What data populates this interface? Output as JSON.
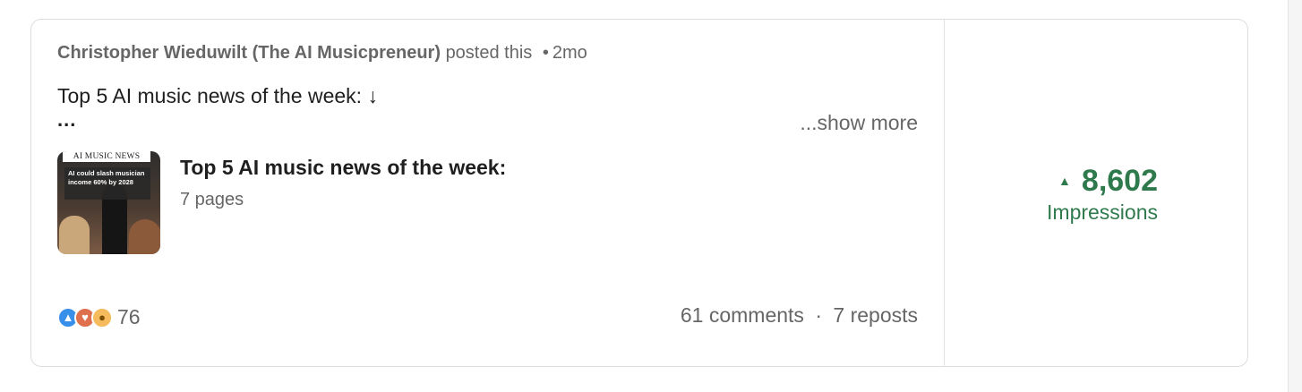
{
  "post": {
    "author": "Christopher Wieduwilt (The AI Musicpreneur)",
    "action": "posted this",
    "separator": "•",
    "age": "2mo",
    "text": "Top 5 AI music news of the week: ↓",
    "ellipsis": "...",
    "show_more": "...show more"
  },
  "document": {
    "thumbnail_masthead": "AI MUSIC NEWS",
    "thumbnail_headline": "AI could slash musician income 60% by 2028",
    "title": "Top 5 AI music news of the week:",
    "pages": "7 pages"
  },
  "engagement": {
    "reaction_icons": [
      "like-icon",
      "love-icon",
      "insightful-icon"
    ],
    "reaction_count": "76",
    "comments": "61 comments",
    "dot": "·",
    "reposts": "7 reposts"
  },
  "stats": {
    "trend_icon": "triangle-up-icon",
    "impressions_value": "8,602",
    "impressions_label": "Impressions",
    "accent_color": "#2f7a4d"
  }
}
